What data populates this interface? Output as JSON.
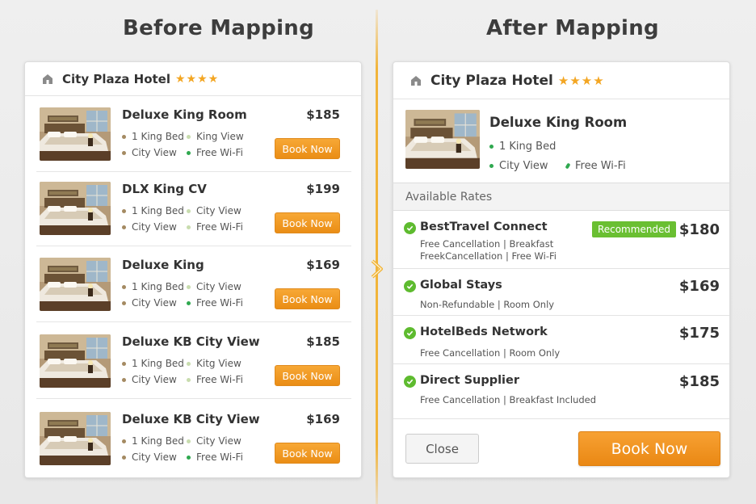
{
  "headings": {
    "before": "Before Mapping",
    "after": "After Mapping"
  },
  "hotel": {
    "name": "City Plaza Hotel",
    "stars": "★★★★"
  },
  "colors": {
    "accent": "#f3a623",
    "book": "#ee921b",
    "recommended": "#6abf32",
    "check": "#5ebb2f"
  },
  "before": {
    "rooms": [
      {
        "title": "Deluxe King Room",
        "price": "$185",
        "bed": "1 King Bed",
        "view": "King View",
        "view2": "City View",
        "wifi": "Free Wi-Fi",
        "book": "Book Now"
      },
      {
        "title": "DLX King CV",
        "price": "$199",
        "bed": "1 King Bed",
        "view": "City View",
        "view2": "City View",
        "wifi": "Free Wi-Fi",
        "book": "Book Now"
      },
      {
        "title": "Deluxe King",
        "price": "$169",
        "bed": "1 King Bed",
        "view": "City View",
        "view2": "City View",
        "wifi": "Free Wi-Fi",
        "book": "Book Now"
      },
      {
        "title": "Deluxe KB City View",
        "price": "$185",
        "bed": "1 King Bed",
        "view": "Kitg View",
        "view2": "City View",
        "wifi": "Free Wi-Fi",
        "book": "Book Now"
      },
      {
        "title": "Deluxe KB City View",
        "price": "$169",
        "bed": "1 King Bed",
        "view": "City View",
        "view2": "City View",
        "wifi": "Free Wi-Fi",
        "book": "Book Now"
      }
    ]
  },
  "after": {
    "room": {
      "title": "Deluxe King Room",
      "bed": "1 King Bed",
      "view": "City View",
      "wifi": "Free Wi-Fi"
    },
    "available_label": "Available Rates",
    "rates": [
      {
        "provider": "BestTravel Connect",
        "badge": "Recommended",
        "price": "$180",
        "line1": "Free Cancellation  |  Breakfast",
        "line2": "FreekCancellation  |  Free Wi-Fi"
      },
      {
        "provider": "Global Stays",
        "price": "$169",
        "line1": "Non-Refundable  |  Room Only"
      },
      {
        "provider": "HotelBeds Network",
        "price": "$175",
        "line1": "Free Cancellation  |  Room Only"
      },
      {
        "provider": "Direct Supplier",
        "price": "$185",
        "line1": "Free Cancellation  |  Breakfast Included"
      }
    ],
    "close": "Close",
    "book": "Book Now"
  }
}
